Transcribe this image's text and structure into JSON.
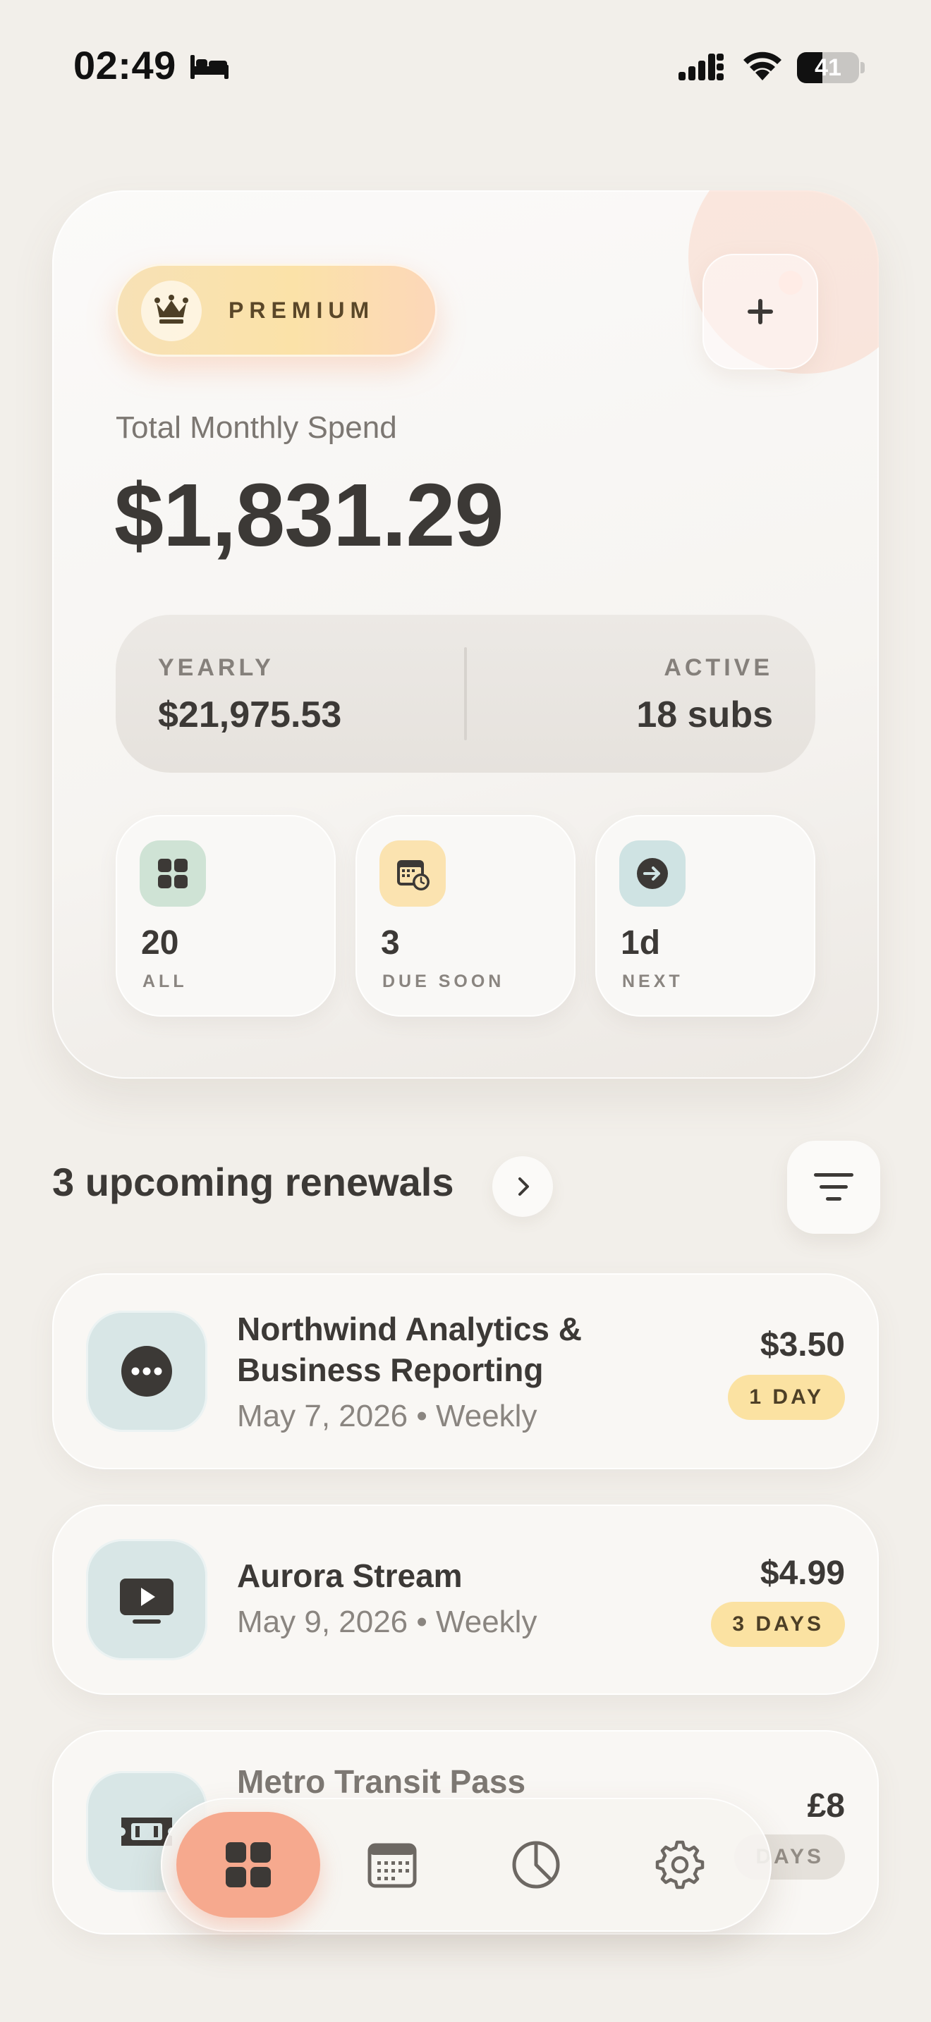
{
  "status_bar": {
    "time": "02:49",
    "focus_icon": "bed-icon",
    "battery_level": 41,
    "battery_label": "41"
  },
  "summary": {
    "badge_label": "PREMIUM",
    "badge_icon": "crown-icon",
    "add_icon": "plus-icon",
    "spend_label": "Total Monthly Spend",
    "spend_amount": "$1,831.29",
    "yearly_label": "YEARLY",
    "yearly_value": "$21,975.53",
    "active_label": "ACTIVE",
    "active_value": "18 subs",
    "tiles": [
      {
        "value": "20",
        "label": "ALL",
        "icon": "grid-icon",
        "color": "#cfe3d5"
      },
      {
        "value": "3",
        "label": "DUE SOON",
        "icon": "calendar-clock-icon",
        "color": "#fbe3b0"
      },
      {
        "value": "1d",
        "label": "NEXT",
        "icon": "arrow-right-circle-icon",
        "color": "#cfe3e3"
      }
    ]
  },
  "upcoming": {
    "title": "3 upcoming renewals",
    "items": [
      {
        "name_line1": "Northwind Analytics &",
        "name_line2": "Business Reporting",
        "meta": "May 7, 2026 • Weekly",
        "price": "$3.50",
        "badge": "1 DAY",
        "icon": "more-icon"
      },
      {
        "name_line1": "Aurora Stream",
        "meta": "May 9, 2026 • Weekly",
        "price": "$4.99",
        "badge": "3 DAYS",
        "icon": "play-tv-icon"
      },
      {
        "name_line1": "Metro Transit Pass",
        "price": "£8",
        "badge": "DAYS",
        "icon": "ticket-icon"
      }
    ]
  },
  "nav": {
    "items": [
      "dashboard-icon",
      "calendar-icon",
      "chart-icon",
      "settings-icon"
    ],
    "active": "dashboard-icon",
    "accent_color": "#f6a98e"
  }
}
